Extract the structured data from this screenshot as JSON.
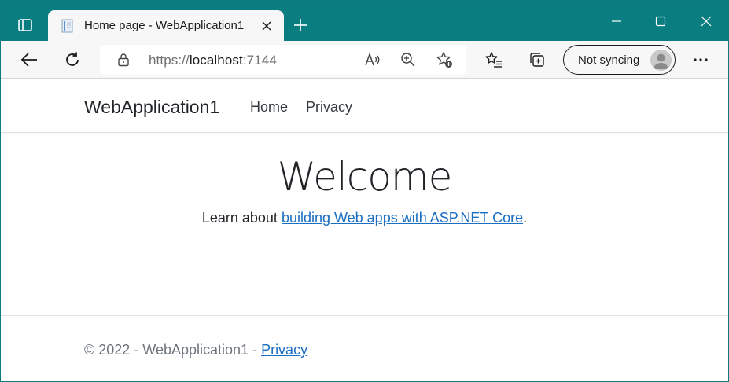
{
  "browser": {
    "tab": {
      "title": "Home page - WebApplication1",
      "favicon": "page-icon"
    },
    "address": {
      "scheme": "https://",
      "host": "localhost",
      "port": ":7144"
    },
    "profile": {
      "label": "Not syncing"
    },
    "colors": {
      "titlebar": "#0a7d80",
      "toolbar": "#f7f7f7"
    }
  },
  "site": {
    "brand": "WebApplication1",
    "nav": [
      {
        "label": "Home"
      },
      {
        "label": "Privacy"
      }
    ],
    "main": {
      "heading": "Welcome",
      "learn_prefix": "Learn about ",
      "learn_link": "building Web apps with ASP.NET Core",
      "learn_suffix": "."
    },
    "footer": {
      "text": "© 2022 - WebApplication1 - ",
      "privacy_link": "Privacy"
    },
    "colors": {
      "link": "#1b6ec2",
      "muted": "#6c757d"
    }
  }
}
